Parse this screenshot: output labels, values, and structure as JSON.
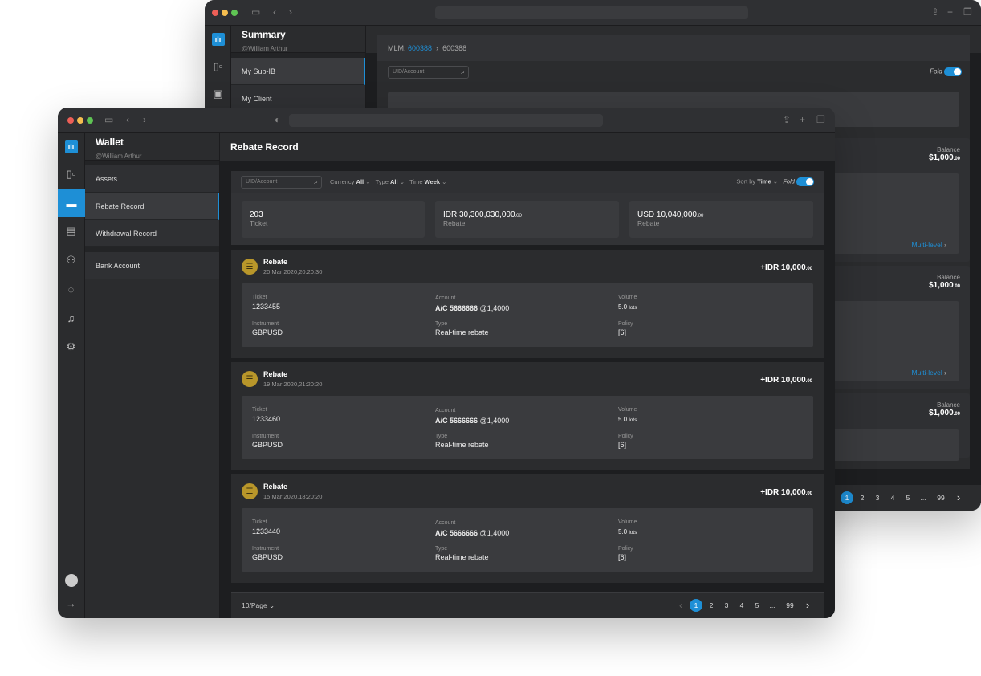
{
  "back": {
    "sidebar": {
      "title": "Summary",
      "user": "@William Arthur",
      "items": [
        {
          "label": "My Sub-IB"
        },
        {
          "label": "My Client"
        }
      ]
    },
    "header": {
      "title": "My Sub-IB"
    },
    "breadcrumb": {
      "prefix": "MLM:",
      "link": "600388",
      "current": "600388"
    },
    "search_placeholder": "UID/Account",
    "fold_label": "Fold",
    "cards": [
      {
        "balance_label": "Balance",
        "balance": "$1,000",
        "balance_dec": ".00",
        "link": "Multi-level"
      },
      {
        "balance_label": "Balance",
        "balance": "$1,000",
        "balance_dec": ".00",
        "link": "Multi-level"
      },
      {
        "balance_label": "Balance",
        "balance": "$1,000",
        "balance_dec": ".00"
      }
    ],
    "pages": [
      "2",
      "3",
      "4",
      "5",
      "...",
      "99"
    ]
  },
  "front": {
    "sidebar": {
      "title": "Wallet",
      "user": "@William Arthur",
      "items": [
        {
          "label": "Assets"
        },
        {
          "label": "Rebate Record"
        },
        {
          "label": "Withdrawal Record"
        },
        {
          "label": "Bank Account"
        }
      ]
    },
    "header": {
      "title": "Rebate Record"
    },
    "filters": {
      "search_placeholder": "UID/Account",
      "currency_label": "Currency",
      "currency_value": "All",
      "type_label": "Type",
      "type_value": "All",
      "time_label": "Time",
      "time_value": "Week",
      "sort_label": "Sort by",
      "sort_value": "Time",
      "fold_label": "Fold"
    },
    "summary": [
      {
        "value": "203",
        "dec": "",
        "label": "Ticket"
      },
      {
        "value": "IDR 30,300,030,000",
        "dec": ".00",
        "label": "Rebate"
      },
      {
        "value": "USD 10,040,000",
        "dec": ".00",
        "label": "Rebate"
      }
    ],
    "records": [
      {
        "title": "Rebate",
        "time": "20 Mar 2020,20:20:30",
        "amount": "+IDR 10,000",
        "amount_dec": ".00",
        "ticket": "1233455",
        "account": "A/C 5666666",
        "rate": "@1,4000",
        "volume": "5.0",
        "volume_unit": "lots",
        "instrument": "GBPUSD",
        "type": "Real-time rebate",
        "policy": "[6]"
      },
      {
        "title": "Rebate",
        "time": "19 Mar 2020,21:20:20",
        "amount": "+IDR 10,000",
        "amount_dec": ".00",
        "ticket": "1233460",
        "account": "A/C 5666666",
        "rate": "@1,4000",
        "volume": "5.0",
        "volume_unit": "lots",
        "instrument": "GBPUSD",
        "type": "Real-time rebate",
        "policy": "[6]"
      },
      {
        "title": "Rebate",
        "time": "15 Mar 2020,18:20:20",
        "amount": "+IDR 10,000",
        "amount_dec": ".00",
        "ticket": "1233440",
        "account": "A/C 5666666",
        "rate": "@1,4000",
        "volume": "5.0",
        "volume_unit": "lots",
        "instrument": "GBPUSD",
        "type": "Real-time rebate",
        "policy": "[6]"
      }
    ],
    "labels": {
      "ticket": "Ticket",
      "account": "Account",
      "volume": "Volume",
      "instrument": "Instrument",
      "type": "Type",
      "policy": "Policy"
    },
    "pagination": {
      "per_page": "10/Page",
      "pages": [
        "1",
        "2",
        "3",
        "4",
        "5",
        "...",
        "99"
      ],
      "current": "1"
    }
  },
  "colors": {
    "accent": "#1e8fd6",
    "coin": "#b8962a"
  }
}
